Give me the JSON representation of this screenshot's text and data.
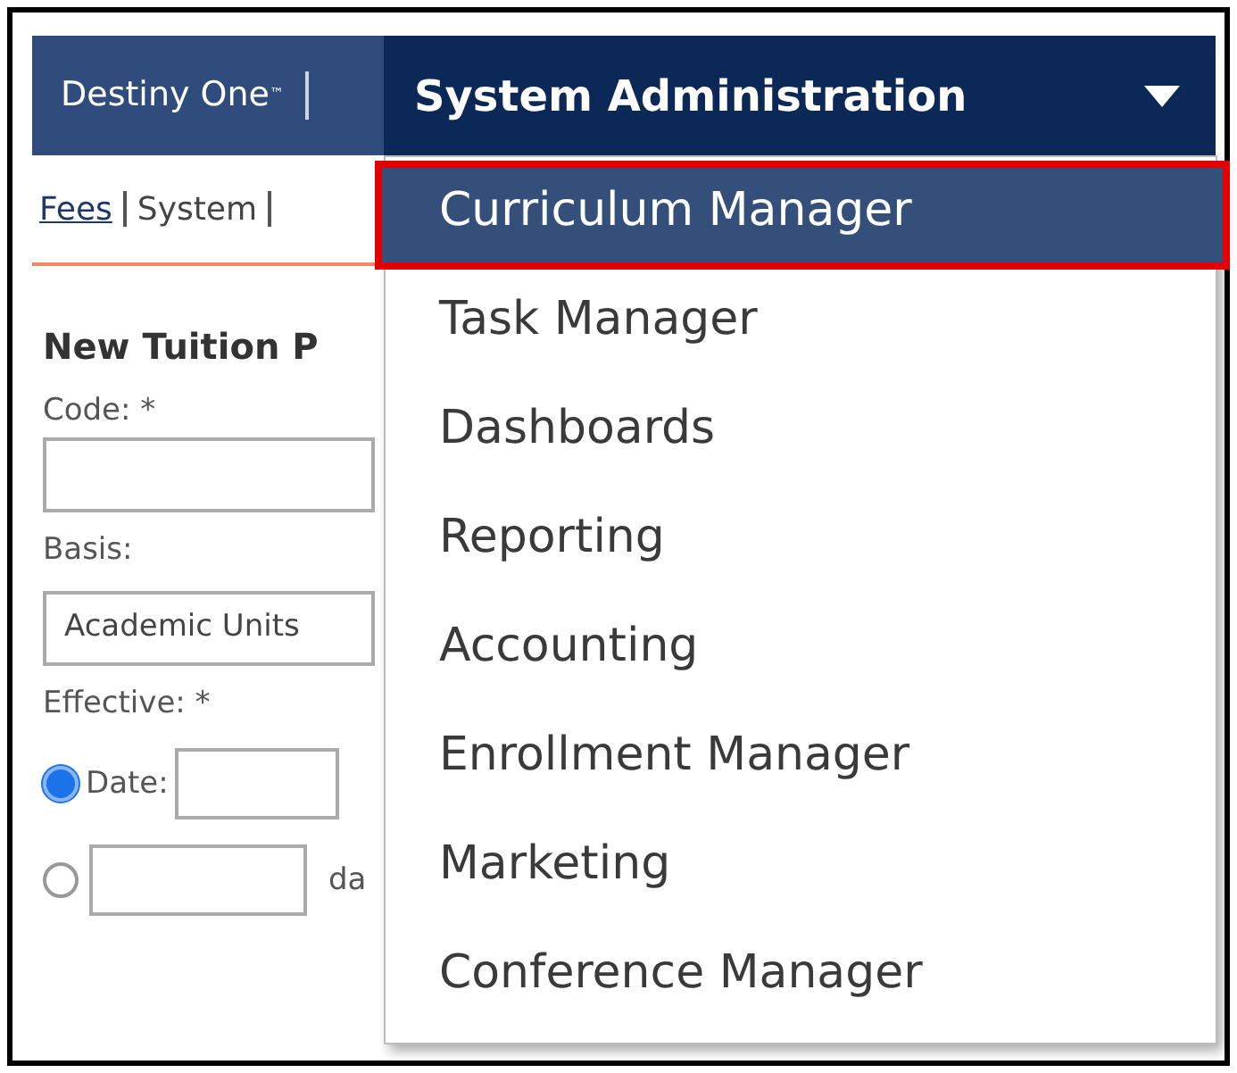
{
  "header": {
    "brand": "Destiny One$^{™}$",
    "module": "System Administration"
  },
  "menu": {
    "expanded": true,
    "items": [
      {
        "label": "Curriculum Manager",
        "selected": true
      },
      {
        "label": "Task Manager",
        "selected": false
      },
      {
        "label": "Dashboards",
        "selected": false
      },
      {
        "label": "Reporting",
        "selected": false
      },
      {
        "label": "Accounting",
        "selected": false
      },
      {
        "label": "Enrollment Manager",
        "selected": false
      },
      {
        "label": "Marketing",
        "selected": false
      },
      {
        "label": "Conference Manager",
        "selected": false
      }
    ]
  },
  "breadcrumb": [
    {
      "label": "Fees",
      "kind": "link"
    },
    {
      "label": "System",
      "kind": "text"
    }
  ],
  "form": {
    "title": "New Tuition P",
    "fields": [
      {
        "kind": "text",
        "label": "Code: *"
      },
      {
        "kind": "select",
        "label": "Basis:",
        "value": "Academic Units"
      },
      {
        "kind": "radios",
        "label": "Effective: *",
        "options": [
          {
            "label": "Date:",
            "selected": true
          },
          {
            "label": "da",
            "selected": false
          }
        ]
      }
    ]
  }
}
